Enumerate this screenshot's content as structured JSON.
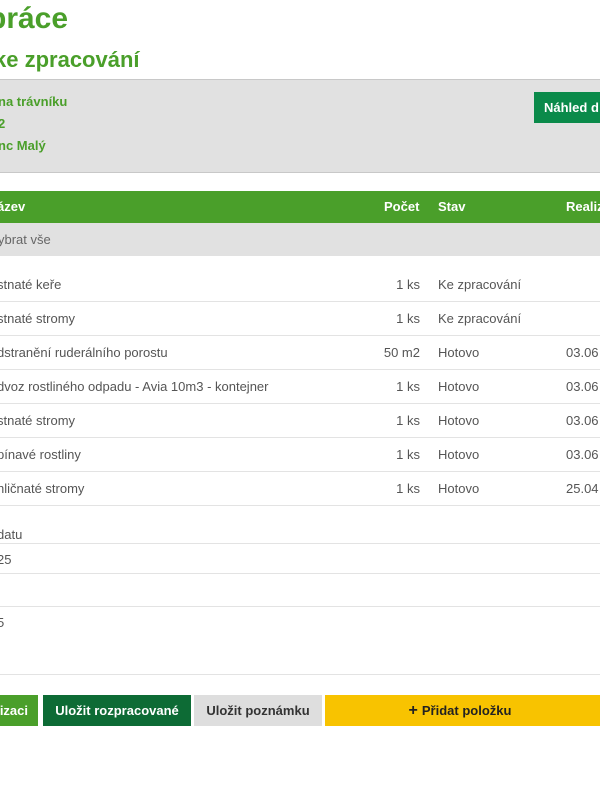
{
  "header": {
    "title": "práce",
    "title_prefix": "",
    "subtitle": "ke zpracování"
  },
  "info": {
    "line1": "na trávníku",
    "line2": "2",
    "line3": "nc Malý",
    "preview_label": "Náhled d"
  },
  "table": {
    "columns": {
      "name": "ázev",
      "count": "Počet",
      "status": "Stav",
      "realization": "Realiz"
    },
    "select_all": "ybrat vše",
    "rows": [
      {
        "name": "stnaté keře",
        "count": "1 ks",
        "status": "Ke zpracování",
        "realization": ""
      },
      {
        "name": "stnaté stromy",
        "count": "1 ks",
        "status": "Ke zpracování",
        "realization": ""
      },
      {
        "name": "dstranění ruderálního porostu",
        "count": "50 m2",
        "status": "Hotovo",
        "realization": "03.06"
      },
      {
        "name": "dvoz rostliného odpadu - Avia 10m3 - kontejner",
        "count": "1 ks",
        "status": "Hotovo",
        "realization": "03.06"
      },
      {
        "name": "stnaté stromy",
        "count": "1 ks",
        "status": "Hotovo",
        "realization": "03.06"
      },
      {
        "name": "pínavé rostliny",
        "count": "1 ks",
        "status": "Hotovo",
        "realization": "03.06"
      },
      {
        "name": "hličnaté stromy",
        "count": "1 ks",
        "status": "Hotovo",
        "realization": "25.04"
      }
    ]
  },
  "dates": {
    "label": "datu",
    "value1": "25",
    "value2": "5"
  },
  "buttons": {
    "realize": "izaci",
    "save_draft": "Uložit rozpracované",
    "save_note": "Uložit poznámku",
    "add_item": "Přidat položku",
    "add_icon": "plus-icon"
  },
  "colors": {
    "brand_green": "#4a9f2a",
    "dark_green": "#0d6b35",
    "preview_green": "#0a8a4a",
    "yellow": "#f8c300",
    "panel_grey": "#e1e1e1"
  }
}
